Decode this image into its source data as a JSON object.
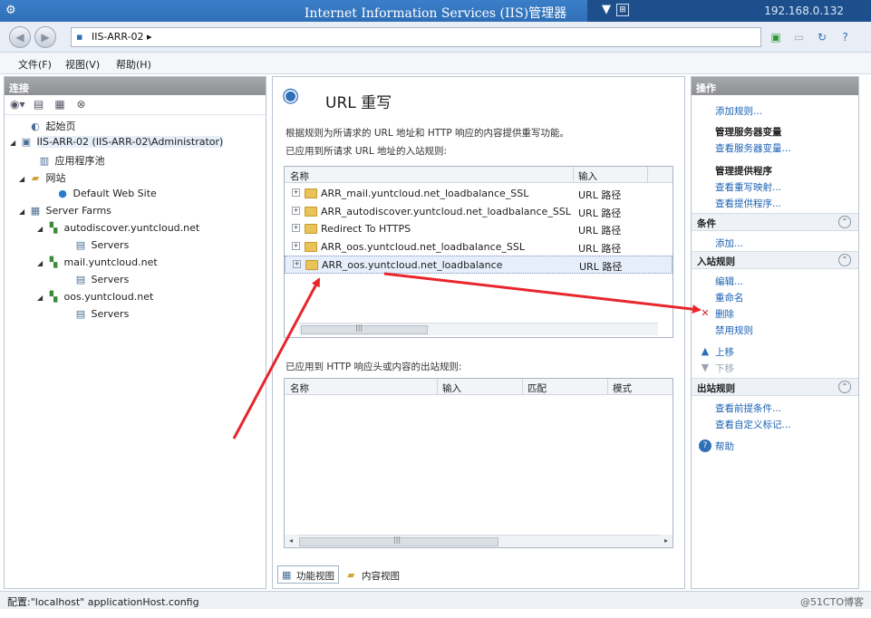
{
  "window": {
    "title": "Internet Information Services (IIS)管理器",
    "remote_ip": "192.168.0.132"
  },
  "address": {
    "crumb": "IIS-ARR-02  ▸"
  },
  "menu": [
    "文件(F)",
    "视图(V)",
    "帮助(H)"
  ],
  "connections": {
    "header": "连接",
    "tree": [
      {
        "label": "起始页",
        "icon": "start-page-icon",
        "depth": 1
      },
      {
        "label": "IIS-ARR-02 (IIS-ARR-02\\Administrator)",
        "icon": "server-icon",
        "depth": 0
      },
      {
        "label": "应用程序池",
        "icon": "app-pools-icon",
        "depth": 2
      },
      {
        "label": "网站",
        "icon": "sites-folder-icon",
        "depth": 2
      },
      {
        "label": "Default Web Site",
        "icon": "globe-icon",
        "depth": 3
      },
      {
        "label": "Server Farms",
        "icon": "server-farms-icon",
        "depth": 2
      },
      {
        "label": "autodiscover.yuntcloud.net",
        "icon": "farm-icon",
        "depth": 3
      },
      {
        "label": "Servers",
        "icon": "servers-icon",
        "depth": 4
      },
      {
        "label": "mail.yuntcloud.net",
        "icon": "farm-icon",
        "depth": 3
      },
      {
        "label": "Servers",
        "icon": "servers-icon",
        "depth": 4
      },
      {
        "label": "oos.yuntcloud.net",
        "icon": "farm-icon",
        "depth": 3
      },
      {
        "label": "Servers",
        "icon": "servers-icon",
        "depth": 4
      }
    ]
  },
  "feature": {
    "title": "URL 重写",
    "description": "根据规则为所请求的 URL 地址和 HTTP 响应的内容提供重写功能。",
    "inbound_label": "已应用到所请求 URL 地址的入站规则:",
    "inbound_columns": [
      "名称",
      "输入"
    ],
    "inbound_rules": [
      {
        "name": "ARR_mail.yuntcloud.net_loadbalance_SSL",
        "input": "URL 路径"
      },
      {
        "name": "ARR_autodiscover.yuntcloud.net_loadbalance_SSL",
        "input": "URL 路径"
      },
      {
        "name": "Redirect To HTTPS",
        "input": "URL 路径"
      },
      {
        "name": "ARR_oos.yuntcloud.net_loadbalance_SSL",
        "input": "URL 路径"
      },
      {
        "name": "ARR_oos.yuntcloud.net_loadbalance",
        "input": "URL 路径"
      }
    ],
    "outbound_label": "已应用到 HTTP 响应头或内容的出站规则:",
    "outbound_columns": [
      "名称",
      "输入",
      "匹配",
      "模式"
    ]
  },
  "view_tabs": [
    "功能视图",
    "内容视图"
  ],
  "actions": {
    "header": "操作",
    "add_rule": "添加规则...",
    "server_vars_title": "管理服务器变量",
    "view_server_vars": "查看服务器变量...",
    "providers_title": "管理提供程序",
    "view_rewrite_maps": "查看重写映射...",
    "view_providers": "查看提供程序...",
    "conditions_header": "条件",
    "add": "添加...",
    "inbound_header": "入站规则",
    "edit": "编辑...",
    "rename": "重命名",
    "delete": "删除",
    "disable_rule": "禁用规则",
    "move_up": "上移",
    "move_down": "下移",
    "outbound_header": "出站规则",
    "view_preconditions": "查看前提条件...",
    "view_custom_tags": "查看自定义标记...",
    "help": "帮助"
  },
  "status": {
    "text": "配置:\"localhost\" applicationHost.config",
    "watermark": "@51CTO博客"
  }
}
